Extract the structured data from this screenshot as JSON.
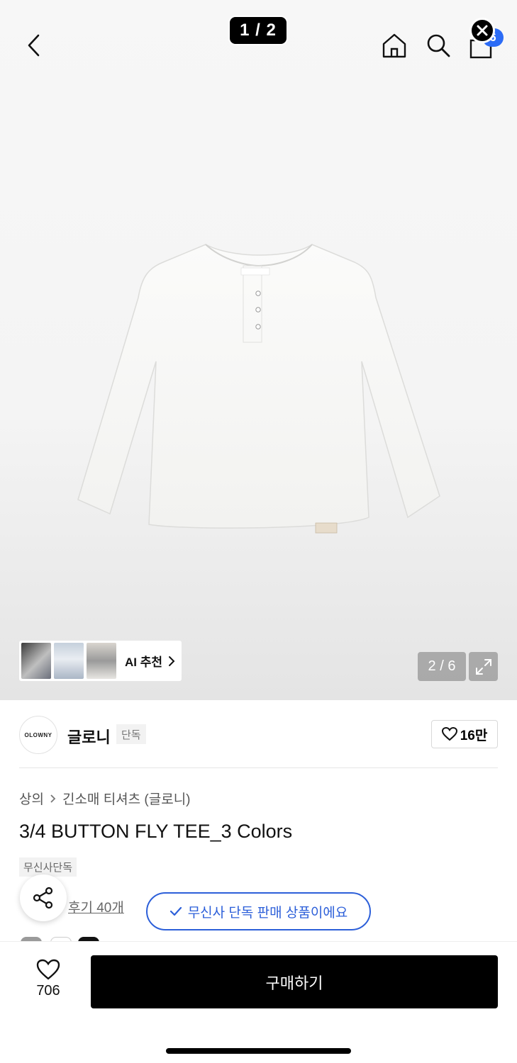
{
  "header": {
    "page_indicator": "1 / 2",
    "cart_count": "6",
    "icons": [
      "back-icon",
      "home-icon",
      "search-icon",
      "cart-icon",
      "close-icon"
    ]
  },
  "gallery": {
    "ai_label": "AI 추천",
    "image_counter": "2 / 6"
  },
  "brand": {
    "logo_text": "OLOWNY",
    "name": "글로니",
    "tag": "단독",
    "like_count": "16만"
  },
  "product": {
    "breadcrumb": [
      "상의",
      "긴소매 티셔츠 (글로니)"
    ],
    "title": "3/4 BUTTON FLY TEE_3 Colors",
    "exclusive_tag": "무신사단독",
    "review_link": "후기 40개",
    "exclusive_notice": "무신사 단독 판매 상품이에요"
  },
  "bottom": {
    "fav_count": "706",
    "buy_label": "구매하기"
  },
  "colors": {
    "accent_blue": "#2c5fd9",
    "badge_blue": "#2c6cf6"
  }
}
